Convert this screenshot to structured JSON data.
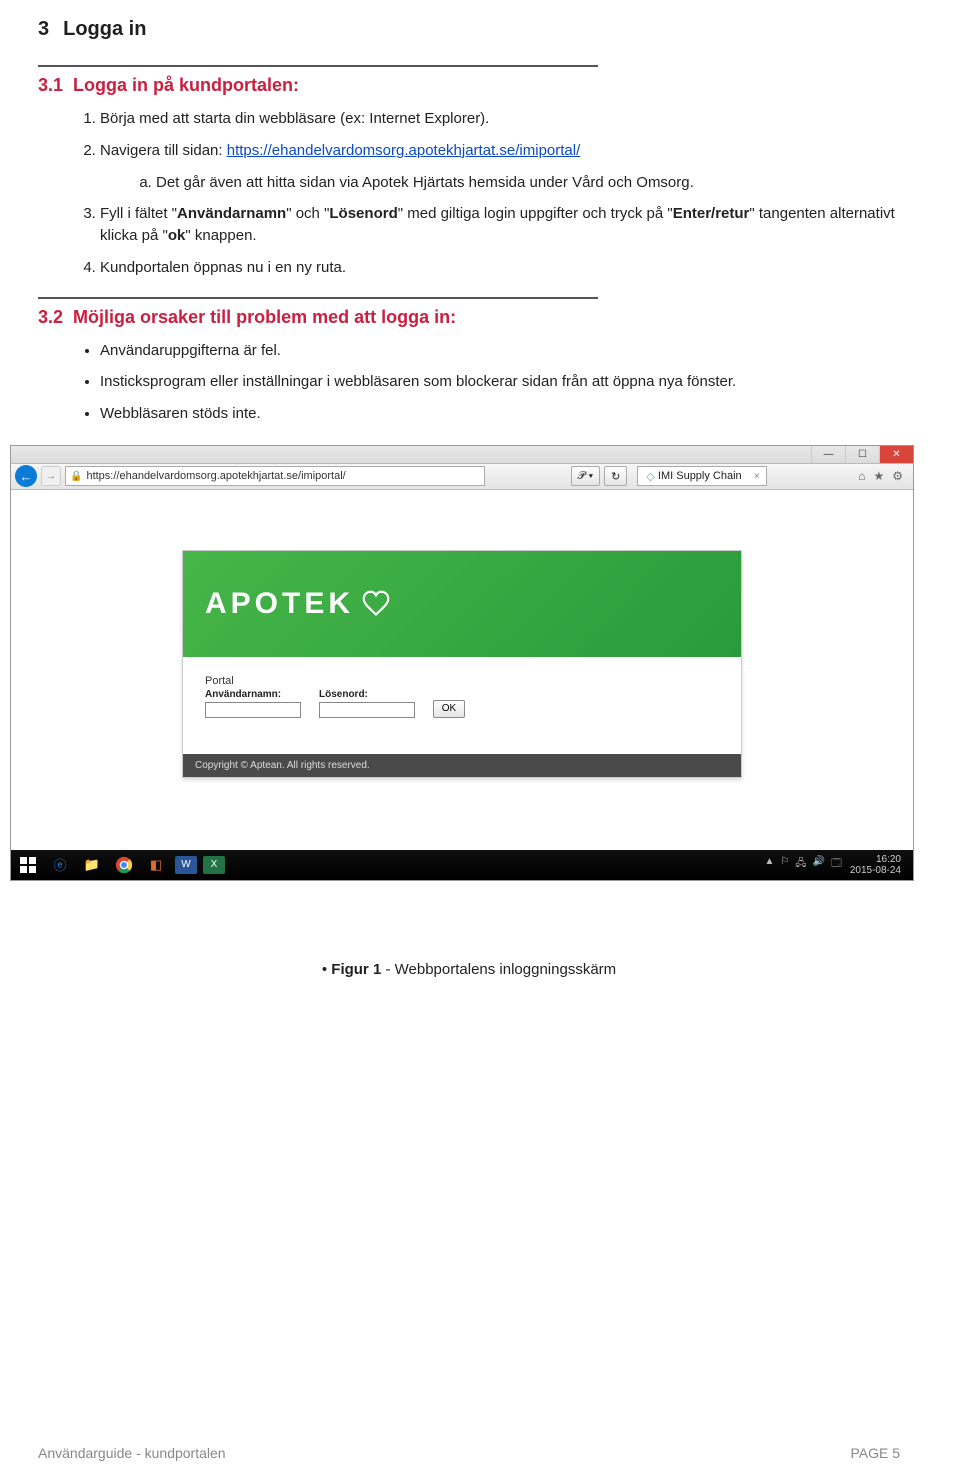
{
  "header": {
    "section_num": "3",
    "section_title": "Logga in"
  },
  "section31": {
    "num": "3.1",
    "title": "Logga in på kundportalen:",
    "steps": [
      {
        "n": "1.",
        "text": "Börja med att starta din webbläsare (ex: Internet Explorer)."
      },
      {
        "n": "2.",
        "text_pre": "Navigera till sidan: ",
        "link": "https://ehandelvardomsorg.apotekhjartat.se/imiportal/",
        "sub": [
          "Det går även att hitta sidan via Apotek Hjärtats hemsida under Vård och Omsorg."
        ]
      },
      {
        "n": "3.",
        "text_parts": [
          "Fyll i fältet \"",
          "Användarnamn",
          "\" och \"",
          "Lösenord",
          "\" med giltiga login uppgifter och tryck på \"",
          "Enter/retur",
          "\" tangenten alternativt klicka på \"",
          "ok",
          "\" knappen."
        ]
      },
      {
        "n": "4.",
        "text": "Kundportalen öppnas nu i en ny ruta."
      }
    ]
  },
  "section32": {
    "num": "3.2",
    "title": "Möjliga orsaker till problem med att logga in:",
    "bullets": [
      "Användaruppgifterna är fel.",
      "Insticksprogram eller inställningar i webbläsaren som blockerar sidan från att öppna nya fönster.",
      "Webbläsaren stöds inte."
    ]
  },
  "browser": {
    "url": "https://ehandelvardomsorg.apotekhjartat.se/imiportal/",
    "search_hint": "𝒫 ▾",
    "refresh": "↻",
    "tab_title": "IMI Supply Chain",
    "brand": "APOTEK",
    "portal_label": "Portal",
    "user_label": "Användarnamn:",
    "pass_label": "Lösenord:",
    "ok_label": "OK",
    "copyright": "Copyright © Aptean. All rights reserved.",
    "clock_time": "16:20",
    "clock_date": "2015-08-24"
  },
  "figure": {
    "bullet": "•",
    "label": "Figur 1",
    "sep": " - ",
    "caption": "Webbportalens inloggningsskärm"
  },
  "footer": {
    "left": "Användarguide - kundportalen",
    "right": "PAGE 5"
  }
}
